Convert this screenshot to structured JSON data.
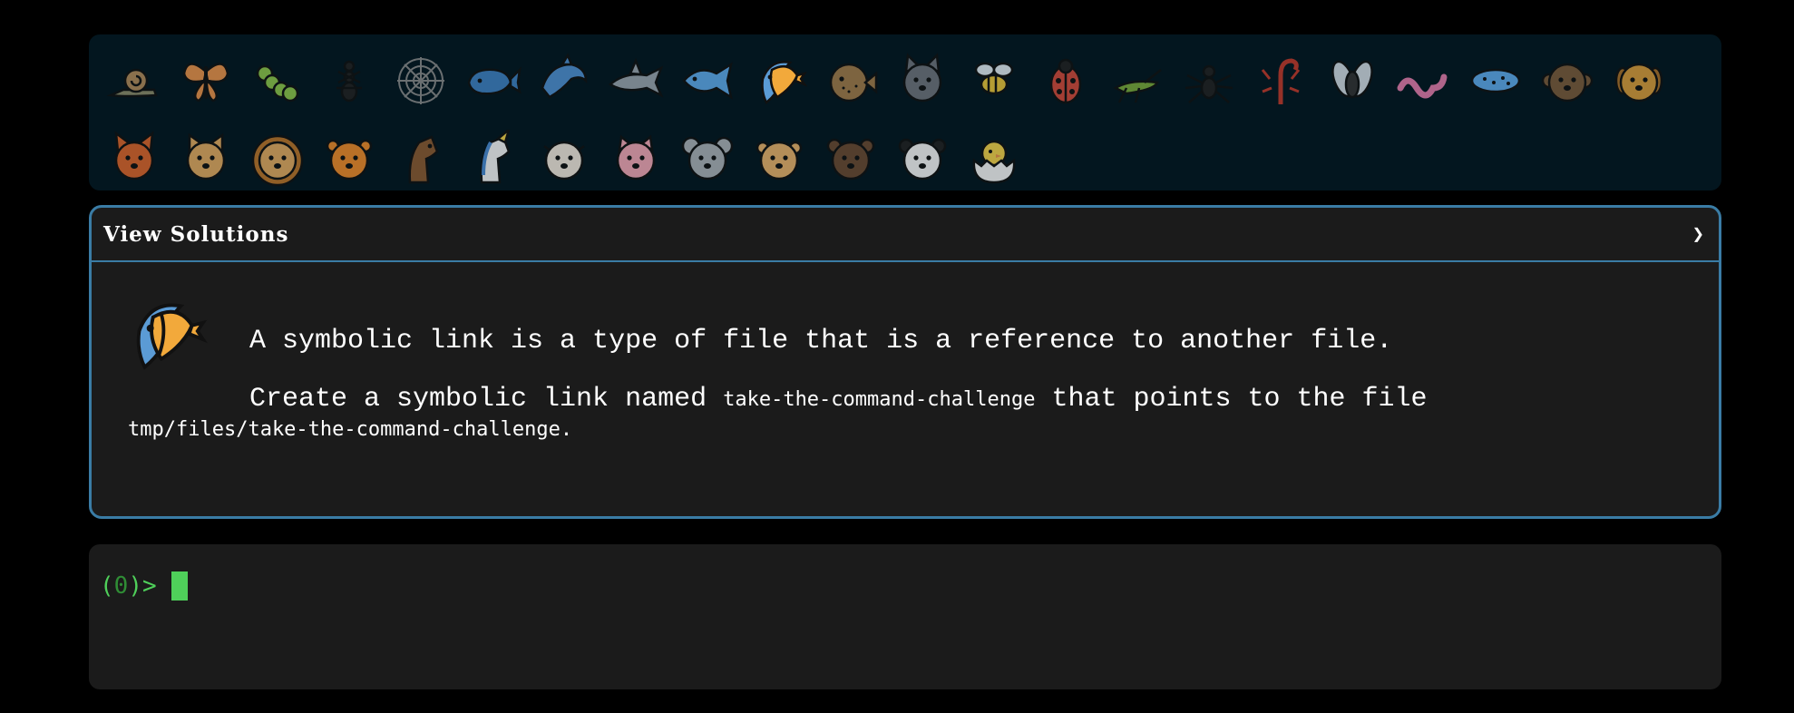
{
  "level_bar": {
    "levels": [
      {
        "name": "snail-icon"
      },
      {
        "name": "butterfly-icon"
      },
      {
        "name": "caterpillar-icon"
      },
      {
        "name": "ant-icon"
      },
      {
        "name": "spider-web-icon"
      },
      {
        "name": "whale-icon"
      },
      {
        "name": "dolphin-icon"
      },
      {
        "name": "shark-icon"
      },
      {
        "name": "fish-icon"
      },
      {
        "name": "tropical-fish-icon",
        "current": true
      },
      {
        "name": "blowfish-icon"
      },
      {
        "name": "wolf-icon"
      },
      {
        "name": "bee-icon"
      },
      {
        "name": "ladybug-icon"
      },
      {
        "name": "cricket-icon"
      },
      {
        "name": "spider-icon"
      },
      {
        "name": "scorpion-icon"
      },
      {
        "name": "fly-icon"
      },
      {
        "name": "worm-icon"
      },
      {
        "name": "microbe-icon"
      },
      {
        "name": "monkey-icon"
      },
      {
        "name": "dog-icon"
      },
      {
        "name": "fox-icon"
      },
      {
        "name": "cat-icon"
      },
      {
        "name": "lion-icon"
      },
      {
        "name": "tiger-icon"
      },
      {
        "name": "horse-icon"
      },
      {
        "name": "unicorn-icon"
      },
      {
        "name": "cow-icon"
      },
      {
        "name": "pig-icon"
      },
      {
        "name": "mouse-icon"
      },
      {
        "name": "hamster-icon"
      },
      {
        "name": "bear-icon"
      },
      {
        "name": "panda-icon"
      },
      {
        "name": "hatching-chick-icon"
      }
    ]
  },
  "challenge": {
    "header": "View Solutions",
    "chevron": "❯",
    "icon": "tropical-fish-icon",
    "description": "A symbolic link is a type of file that is a reference to another file.",
    "task_prefix": "Create a symbolic link named ",
    "link_name": "take-the-command-challenge",
    "task_middle": " that points to the file",
    "target_path": "tmp/files/take-the-command-challenge",
    "task_suffix": "."
  },
  "terminal": {
    "prompt_open": "(",
    "exit_code": "0",
    "prompt_close": ")>"
  },
  "colors": {
    "background": "#000000",
    "level_bar": "#03161f",
    "panel": "#1b1b1b",
    "accent_border": "#3a7ca5",
    "prompt_green": "#4fd05a"
  }
}
